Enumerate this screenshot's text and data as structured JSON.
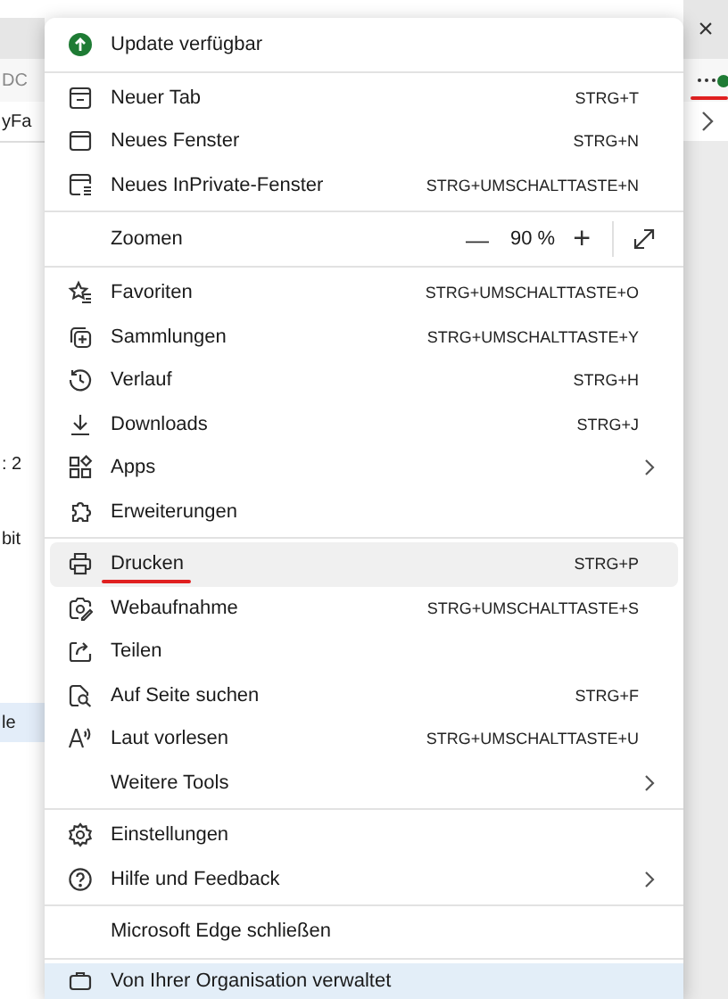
{
  "page": {
    "left_fragments": [
      {
        "text": "DC",
        "kind": "tab"
      },
      {
        "text": "yFa",
        "kind": "bar"
      },
      {
        "text": ": 2",
        "kind": "text"
      },
      {
        "text": "bit",
        "kind": "text"
      },
      {
        "text": "le",
        "kind": "highlight"
      }
    ],
    "close_glyph": "×",
    "more_button": {
      "badge": true,
      "annotated": true
    }
  },
  "menu": {
    "sections": [
      [
        {
          "kind": "update",
          "label": "Update verfügbar"
        }
      ],
      [
        {
          "kind": "item",
          "label": "Neuer Tab",
          "shortcut": "STRG+T",
          "submenu": false,
          "hovered": false,
          "annotated": false
        },
        {
          "kind": "item",
          "label": "Neues Fenster",
          "shortcut": "STRG+N",
          "submenu": false,
          "hovered": false,
          "annotated": false
        },
        {
          "kind": "item",
          "label": "Neues InPrivate-Fenster",
          "shortcut": "STRG+UMSCHALTTASTE+N",
          "submenu": false,
          "hovered": false,
          "annotated": false
        }
      ],
      [
        {
          "kind": "zoom",
          "label": "Zoomen",
          "minus": "—",
          "value": "90 %",
          "plus": "+"
        }
      ],
      [
        {
          "kind": "item",
          "label": "Favoriten",
          "shortcut": "STRG+UMSCHALTTASTE+O",
          "submenu": false,
          "hovered": false,
          "annotated": false
        },
        {
          "kind": "item",
          "label": "Sammlungen",
          "shortcut": "STRG+UMSCHALTTASTE+Y",
          "submenu": false,
          "hovered": false,
          "annotated": false
        },
        {
          "kind": "item",
          "label": "Verlauf",
          "shortcut": "STRG+H",
          "submenu": false,
          "hovered": false,
          "annotated": false
        },
        {
          "kind": "item",
          "label": "Downloads",
          "shortcut": "STRG+J",
          "submenu": false,
          "hovered": false,
          "annotated": false
        },
        {
          "kind": "item",
          "label": "Apps",
          "submenu": true,
          "hovered": false,
          "annotated": false
        },
        {
          "kind": "item",
          "label": "Erweiterungen",
          "submenu": false,
          "hovered": false,
          "annotated": false
        }
      ],
      [
        {
          "kind": "item",
          "label": "Drucken",
          "shortcut": "STRG+P",
          "submenu": false,
          "hovered": true,
          "annotated": true
        },
        {
          "kind": "item",
          "label": "Webaufnahme",
          "shortcut": "STRG+UMSCHALTTASTE+S",
          "submenu": false,
          "hovered": false,
          "annotated": false
        },
        {
          "kind": "item",
          "label": "Teilen",
          "submenu": false,
          "hovered": false,
          "annotated": false
        },
        {
          "kind": "item",
          "label": "Auf Seite suchen",
          "shortcut": "STRG+F",
          "submenu": false,
          "hovered": false,
          "annotated": false
        },
        {
          "kind": "item",
          "label": "Laut vorlesen",
          "shortcut": "STRG+UMSCHALTTASTE+U",
          "submenu": false,
          "hovered": false,
          "annotated": false
        },
        {
          "kind": "item",
          "label": "Weitere Tools",
          "submenu": true,
          "hovered": false,
          "annotated": false
        }
      ],
      [
        {
          "kind": "item",
          "label": "Einstellungen",
          "submenu": false,
          "hovered": false,
          "annotated": false
        },
        {
          "kind": "item",
          "label": "Hilfe und Feedback",
          "submenu": true,
          "hovered": false,
          "annotated": false
        }
      ],
      [
        {
          "kind": "item",
          "label": "Microsoft Edge schließen",
          "submenu": false,
          "hovered": false,
          "annotated": false
        }
      ],
      [
        {
          "kind": "managed",
          "label": "Von Ihrer Organisation verwaltet"
        }
      ]
    ]
  }
}
